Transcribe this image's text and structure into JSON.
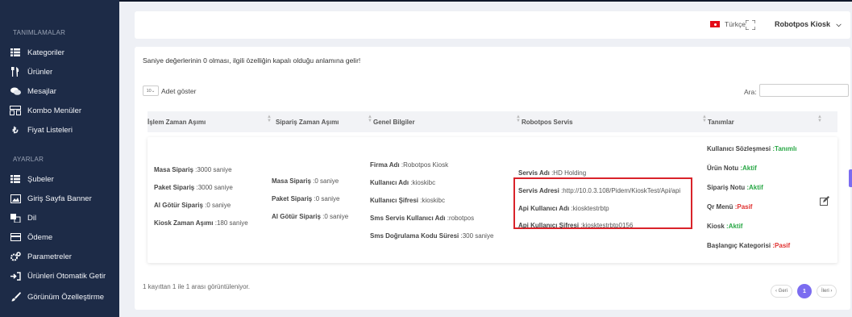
{
  "sidebar": {
    "section_definitions": "TANIMLAMALAR",
    "items_definitions": [
      {
        "label": "Kategoriler",
        "icon": "list-icon"
      },
      {
        "label": "Ürünler",
        "icon": "cutlery-icon"
      },
      {
        "label": "Mesajlar",
        "icon": "chat-icon"
      },
      {
        "label": "Kombo Menüler",
        "icon": "combo-icon"
      },
      {
        "label": "Fiyat Listeleri",
        "icon": "currency-icon"
      }
    ],
    "section_settings": "AYARLAR",
    "items_settings": [
      {
        "label": "Şubeler",
        "icon": "list-icon"
      },
      {
        "label": "Giriş Sayfa Banner",
        "icon": "image-icon"
      },
      {
        "label": "Dil",
        "icon": "language-icon"
      },
      {
        "label": "Ödeme",
        "icon": "credit-card-icon"
      },
      {
        "label": "Parametreler",
        "icon": "gears-icon"
      },
      {
        "label": "Ürünleri Otomatik Getir",
        "icon": "sign-in-icon"
      },
      {
        "label": "Görünüm Özelleştirme",
        "icon": "brush-icon"
      }
    ]
  },
  "header": {
    "language": "Türkçe",
    "user": "Robotpos Kiosk"
  },
  "main": {
    "note": "Saniye değerlerinin 0 olması, ilgili özelliğin kapalı olduğu anlamına gelir!",
    "length_value": "10",
    "length_label": "Adet göster",
    "search_label": "Ara:",
    "columns": [
      "İşlem Zaman Aşımı",
      "Sipariş Zaman Aşımı",
      "Genel Bilgiler",
      "Robotpos Servis",
      "Tanımlar"
    ],
    "row": {
      "islem": [
        {
          "k": "Masa Sipariş",
          "v": ":3000 saniye"
        },
        {
          "k": "Paket Sipariş",
          "v": ":3000 saniye"
        },
        {
          "k": "Al Götür Sipariş",
          "v": ":0 saniye"
        },
        {
          "k": "Kiosk Zaman Aşımı",
          "v": ":180 saniye"
        }
      ],
      "siparis": [
        {
          "k": "Masa Sipariş",
          "v": ":0 saniye"
        },
        {
          "k": "Paket Sipariş",
          "v": ":0 saniye"
        },
        {
          "k": "Al Götür Sipariş",
          "v": ":0 saniye"
        }
      ],
      "genel": [
        {
          "k": "Firma Adı",
          "v": ":Robotpos Kiosk"
        },
        {
          "k": "Kullanıcı Adı",
          "v": ":kioskibc"
        },
        {
          "k": "Kullanıcı Şifresi",
          "v": ":kioskibc"
        },
        {
          "k": "Sms Servis Kullanıcı Adı",
          "v": ":robotpos"
        },
        {
          "k": "Sms Doğrulama Kodu Süresi",
          "v": ":300 saniye"
        }
      ],
      "servis": [
        {
          "k": "Servis Adı",
          "v": ":HD Holding"
        },
        {
          "k": "Servis Adresi",
          "v": ":http://10.0.3.108/Pidem/KioskTest/Api/api"
        },
        {
          "k": "Api Kullanıcı Adı",
          "v": ":kiosktestrbtp"
        },
        {
          "k": "Api Kullanıcı Şifresi",
          "v": ":kiosktestrbtp0156"
        }
      ],
      "tanimlar": [
        {
          "k": "Kullanıcı Sözleşmesi",
          "v": ":Tanımlı",
          "status": "green"
        },
        {
          "k": "Ürün Notu",
          "v": ":Aktif",
          "status": "green"
        },
        {
          "k": "Sipariş Notu",
          "v": ":Aktif",
          "status": "green"
        },
        {
          "k": "Qr Menü",
          "v": ":Pasif",
          "status": "red"
        },
        {
          "k": "Kiosk",
          "v": ":Aktif",
          "status": "green"
        },
        {
          "k": "Başlangıç Kategorisi",
          "v": ":Pasif",
          "status": "red"
        }
      ]
    },
    "info": "1 kayıttan 1 ile 1 arası görüntüleniyor.",
    "pager": {
      "prev": "‹ Geri",
      "page": "1",
      "next": "İleri ›"
    }
  },
  "colors": {
    "sidebar": "#1d2b47",
    "accent": "#7b6cf0",
    "active": "#28a745",
    "passive": "#e0302f",
    "highlight": "#d9232a"
  }
}
